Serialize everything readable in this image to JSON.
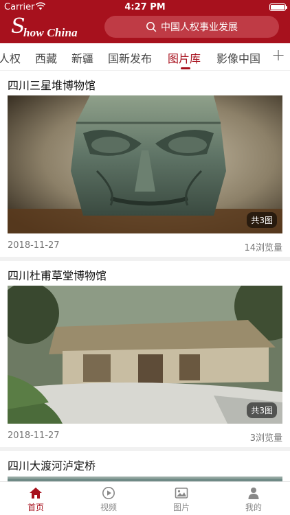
{
  "status_bar": {
    "carrier": "Carrier",
    "time": "4:27 PM"
  },
  "brand": {
    "logo_s": "S",
    "logo_text": "how China"
  },
  "search": {
    "text": "中国人权事业发展"
  },
  "tabs": [
    {
      "label": "人权"
    },
    {
      "label": "西藏"
    },
    {
      "label": "新疆"
    },
    {
      "label": "国新发布"
    },
    {
      "label": "图片库",
      "active": true
    },
    {
      "label": "影像中国"
    }
  ],
  "tab_add": "+",
  "feed": [
    {
      "title": "四川三星堆博物馆",
      "count": "共3图",
      "date": "2018-11-27",
      "views": "14浏览量",
      "image": "bronze-mask-photo"
    },
    {
      "title": "四川杜甫草堂博物馆",
      "count": "共3图",
      "date": "2018-11-27",
      "views": "3浏览量",
      "image": "thatched-cottage-photo"
    },
    {
      "title": "四川大渡河泸定桥",
      "image": "river-bridge-photo"
    }
  ],
  "bottom_nav": [
    {
      "label": "首页",
      "icon": "home-icon",
      "active": true
    },
    {
      "label": "视频",
      "icon": "play-icon"
    },
    {
      "label": "图片",
      "icon": "image-icon"
    },
    {
      "label": "我的",
      "icon": "user-icon"
    }
  ],
  "colors": {
    "brand_red": "#a7111d",
    "search_bg": "#bf3b45",
    "inactive": "#888888"
  }
}
